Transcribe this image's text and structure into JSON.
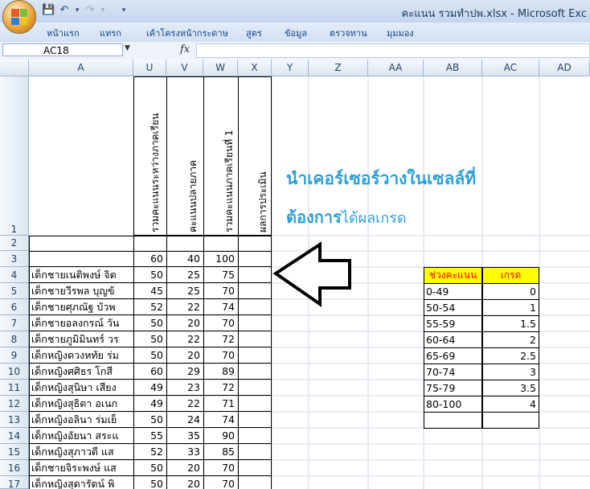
{
  "window": {
    "title": "คะแนน รวมทำปพ.xlsx - Microsoft Exc"
  },
  "ribbon": {
    "tabs": [
      "หน้าแรก",
      "แทรก",
      "เค้าโครงหน้ากระดาษ",
      "สูตร",
      "ข้อมูล",
      "ตรวจทาน",
      "มุมมอง"
    ]
  },
  "formula_bar": {
    "name_box": "AC18",
    "fx": "fx",
    "value": ""
  },
  "columns": [
    "A",
    "U",
    "V",
    "W",
    "X",
    "Y",
    "Z",
    "AA",
    "AB",
    "AC",
    "AD"
  ],
  "row_numbers": [
    "1",
    "2",
    "3",
    "4",
    "5",
    "6",
    "7",
    "8",
    "9",
    "10",
    "11",
    "12",
    "13",
    "14",
    "15",
    "16",
    "17"
  ],
  "headers": {
    "U": "รวมคะแนนระหว่างภาคเรียน",
    "V": "คะแนนปลายภาค",
    "W": "รวมคะแนนภาคเรียนที่ 1",
    "X": "ผลการประเมิน"
  },
  "row3": {
    "U": "60",
    "V": "40",
    "W": "100"
  },
  "students": [
    {
      "name": "เด็กชายเนติพงษ์  จิต",
      "U": "50",
      "V": "25",
      "W": "75"
    },
    {
      "name": "เด็กชายวีรพล  บุญข้",
      "U": "45",
      "V": "25",
      "W": "70"
    },
    {
      "name": "เด็กชายศุภณัฐ  บัวพ",
      "U": "52",
      "V": "22",
      "W": "74"
    },
    {
      "name": "เด็กชายอลงกรณ์  วัน",
      "U": "50",
      "V": "20",
      "W": "70"
    },
    {
      "name": "เด็กชายภูมิมินทร์  วร",
      "U": "50",
      "V": "22",
      "W": "72"
    },
    {
      "name": "เด็กหญิงดวงหทัย  ร่ม",
      "U": "50",
      "V": "20",
      "W": "70"
    },
    {
      "name": "เด็กหญิงศศิธร  โกสี",
      "U": "60",
      "V": "29",
      "W": "89"
    },
    {
      "name": "เด็กหญิงสุนิษา  เสียง",
      "U": "49",
      "V": "23",
      "W": "72"
    },
    {
      "name": "เด็กหญิงสุธิดา  อเนก",
      "U": "49",
      "V": "22",
      "W": "71"
    },
    {
      "name": "เด็กหญิงอลินา  ร่มเย็",
      "U": "50",
      "V": "24",
      "W": "74"
    },
    {
      "name": "เด็กหญิงอัยนา  สระแ",
      "U": "55",
      "V": "35",
      "W": "90"
    },
    {
      "name": "เด็กหญิงสุภาวดี   แส",
      "U": "52",
      "V": "33",
      "W": "85"
    },
    {
      "name": "เด็กชายจิระพงษ์  แส",
      "U": "50",
      "V": "20",
      "W": "70"
    },
    {
      "name": "เด็กหญิงสุดารัตน์   พิ",
      "U": "50",
      "V": "20",
      "W": "70"
    }
  ],
  "grade_table": {
    "header_range": "ช่วงคะแนน",
    "header_grade": "เกรด",
    "rows": [
      {
        "range": "0-49",
        "grade": "0"
      },
      {
        "range": "50-54",
        "grade": "1"
      },
      {
        "range": "55-59",
        "grade": "1.5"
      },
      {
        "range": "60-64",
        "grade": "2"
      },
      {
        "range": "65-69",
        "grade": "2.5"
      },
      {
        "range": "70-74",
        "grade": "3"
      },
      {
        "range": "75-79",
        "grade": "3.5"
      },
      {
        "range": "80-100",
        "grade": "4"
      }
    ]
  },
  "annotation": {
    "line1": "นำเคอร์เซอร์วางในเซลล์ที่",
    "line2_bold": "ต้องการ",
    "line2_rest": "ได้ผลเกรด"
  },
  "colors": {
    "header_fill": "#ffff00",
    "header_text": "#ff0000",
    "annotation": "#2e9fd6"
  }
}
